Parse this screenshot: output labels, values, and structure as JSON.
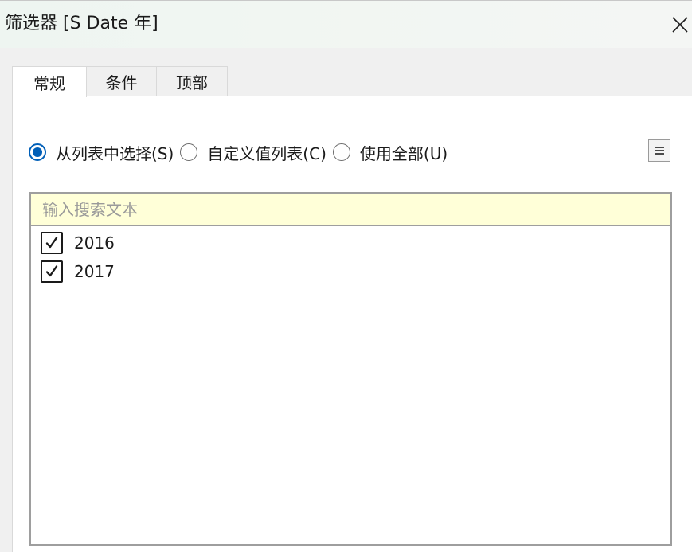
{
  "window": {
    "title": "筛选器 [S Date 年]"
  },
  "tabs": [
    {
      "label": "常规",
      "active": true
    },
    {
      "label": "条件",
      "active": false
    },
    {
      "label": "顶部",
      "active": false
    }
  ],
  "selection_mode": {
    "options": [
      {
        "label": "从列表中选择(S)",
        "selected": true
      },
      {
        "label": "自定义值列表(C)",
        "selected": false
      },
      {
        "label": "使用全部(U)",
        "selected": false
      }
    ]
  },
  "search": {
    "placeholder": "输入搜索文本",
    "value": ""
  },
  "list": {
    "items": [
      {
        "label": "2016",
        "checked": true
      },
      {
        "label": "2017",
        "checked": true
      }
    ]
  },
  "icons": {
    "close": "close-icon",
    "menu": "list-menu-icon",
    "check": "checkmark-icon"
  },
  "colors": {
    "accent": "#005fb8",
    "search_bg": "#ffffd8"
  }
}
